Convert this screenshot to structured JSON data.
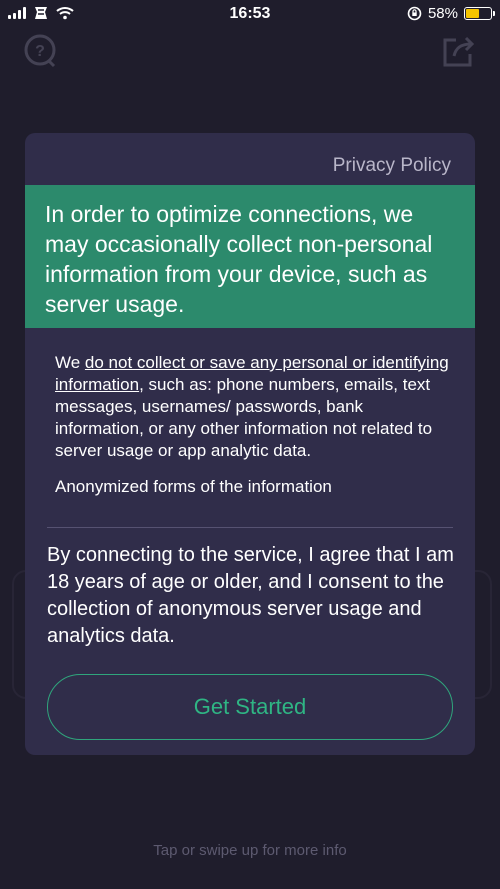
{
  "status_bar": {
    "time": "16:53",
    "battery_percent": "58%",
    "battery_level": 0.58
  },
  "background": {
    "hint": "Tap or swipe up for more info"
  },
  "modal": {
    "policy_link": "Privacy Policy",
    "banner_text": "In order to optimize connections, we may occasionally collect non-personal information from your device, such as server usage.",
    "body_prefix": "We ",
    "body_underlined": "do not collect or save any personal or identifying information",
    "body_suffix": ", such as: phone numbers, emails, text messages, usernames/ passwords, bank information, or any other information not related to server usage or app analytic data.",
    "body_cutoff": "Anonymized forms of the information",
    "consent_text": "By connecting to the service, I agree that I am 18 years of age or older, and I consent to the collection of anonymous server usage and analytics data.",
    "cta_label": "Get Started"
  },
  "colors": {
    "background": "#1f1d2c",
    "modal": "#302d4a",
    "banner": "#2c8a6c",
    "accent": "#2fb584"
  }
}
